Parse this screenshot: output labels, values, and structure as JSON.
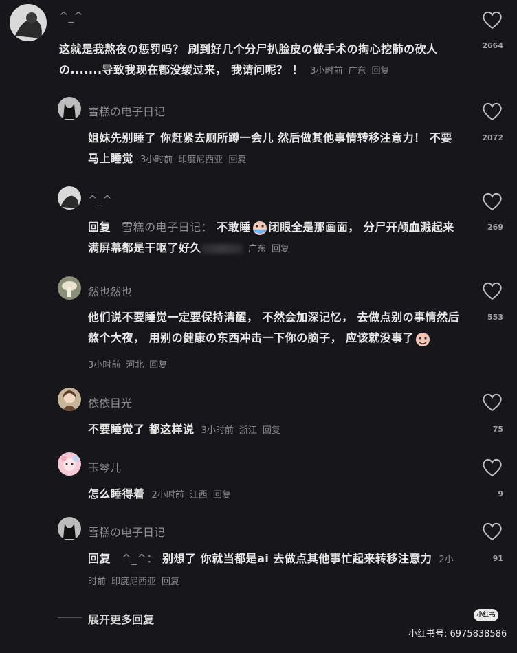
{
  "comments": [
    {
      "user": "^_^",
      "text": "这就是我熬夜の惩罚吗？ 刷到好几个分尸扒脸皮の做手术の掏心挖肺の砍人の.......导致我现在都没缓过来， 我请问呢？ ！",
      "time": "3小时前",
      "location": "广东",
      "reply": "回复",
      "likes": "2664",
      "avatar_icon": "dark-figure-avatar"
    },
    {
      "user": "雪糕の电子日记",
      "text": "姐妹先别睡了 你赶紧去厕所蹲一会儿 然后做其他事情转移注意力！ 不要马上睡觉",
      "time": "3小时前",
      "location": "印度尼西亚",
      "reply": "回复",
      "likes": "2072",
      "avatar_icon": "black-cat-avatar"
    },
    {
      "user": "^_^",
      "reply_prefix": "回复",
      "reply_to": "雪糕の电子日记：",
      "text_a": "不敢睡",
      "text_b": "闭眼全是那画面， 分尸开颅血溅起来满屏幕都是干呕了好久",
      "time": "",
      "location": "广东",
      "reply": "回复",
      "likes": "269",
      "avatar_icon": "dark-figure-avatar",
      "emoji_icon": "crying-face-icon"
    },
    {
      "user": "然也然也",
      "text": "他们说不要睡觉一定要保持清醒， 不然会加深记忆， 去做点别の事情然后熬个大夜， 用别の健康の东西冲击一下你の脑子， 应该就没事了",
      "time": "3小时前",
      "location": "河北",
      "reply": "回复",
      "likes": "553",
      "avatar_icon": "mushroom-avatar",
      "emoji_icon": "peach-face-icon"
    },
    {
      "user": "依依目光",
      "text": "不要睡觉了 都这样说",
      "time": "3小时前",
      "location": "浙江",
      "reply": "回复",
      "likes": "75",
      "avatar_icon": "girl-avatar"
    },
    {
      "user": "玉琴儿",
      "text": "怎么睡得着",
      "time": "2小时前",
      "location": "江西",
      "reply": "回复",
      "likes": "9",
      "avatar_icon": "pink-cartoon-avatar"
    },
    {
      "user": "雪糕の电子日记",
      "reply_prefix": "回复",
      "reply_to": "^_^：",
      "text": "别想了 你就当都是ai 去做点其他事忙起来转移注意力",
      "time": "2小时前",
      "location": "印度尼西亚",
      "reply": "回复",
      "likes": "91",
      "avatar_icon": "black-cat-avatar"
    }
  ],
  "expand_label": "展开更多回复",
  "watermark_badge": "小红书",
  "watermark_text": "小红书号: 6975838586",
  "colors": {
    "background": "#17171b",
    "username": "#8d8d93",
    "meta": "#8b8b90",
    "text": "#e8e8e8"
  }
}
